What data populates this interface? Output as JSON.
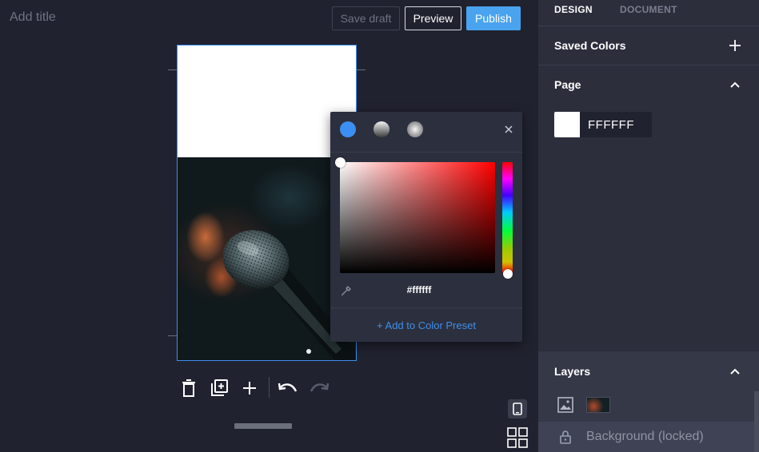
{
  "header": {
    "title_placeholder": "Add title",
    "save_draft_label": "Save draft",
    "preview_label": "Preview",
    "publish_label": "Publish",
    "accent_color": "#4aa3ee"
  },
  "color_picker": {
    "modes": [
      "solid",
      "linear-gradient",
      "radial-gradient"
    ],
    "active_mode": "solid",
    "hex_value": "#ffffff",
    "add_preset_label": "+ Add to Color Preset"
  },
  "toolbar": {
    "items": [
      "delete-icon",
      "duplicate-icon",
      "add-icon",
      "undo-icon",
      "redo-icon"
    ]
  },
  "panel": {
    "tabs": [
      "DESIGN",
      "DOCUMENT"
    ],
    "active_tab": "DESIGN",
    "saved_colors_title": "Saved Colors",
    "page_title": "Page",
    "page_color_hex": "FFFFFF",
    "layers_title": "Layers",
    "layers": [
      {
        "type": "image",
        "label": ""
      },
      {
        "type": "background",
        "label": "Background (locked)"
      }
    ]
  }
}
